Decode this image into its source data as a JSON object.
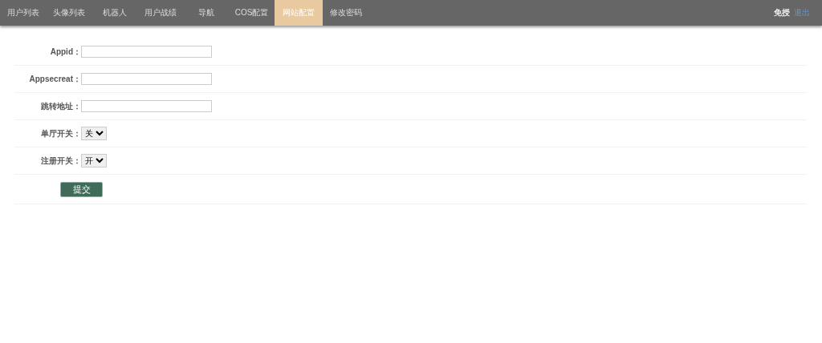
{
  "nav": {
    "tabs": [
      {
        "label": "用户列表",
        "selected": false
      },
      {
        "label": "头像列表",
        "selected": false
      },
      {
        "label": "机器人",
        "selected": false
      },
      {
        "label": "用户战绩",
        "selected": false
      },
      {
        "label": "导航",
        "selected": false
      },
      {
        "label": "COS配置",
        "selected": false
      },
      {
        "label": "网站配置",
        "selected": true
      },
      {
        "label": "修改密码",
        "selected": false
      }
    ],
    "user": "免授",
    "logout": "退出"
  },
  "form": {
    "fields": [
      {
        "kind": "text",
        "label": "Appid："
      },
      {
        "kind": "text",
        "label": "Appsecreat："
      },
      {
        "kind": "text",
        "label": "跳转地址："
      },
      {
        "kind": "select",
        "label": "单厅开关：",
        "value": "关"
      },
      {
        "kind": "select",
        "label": "注册开关：",
        "value": "开"
      }
    ],
    "submit": "提交"
  }
}
